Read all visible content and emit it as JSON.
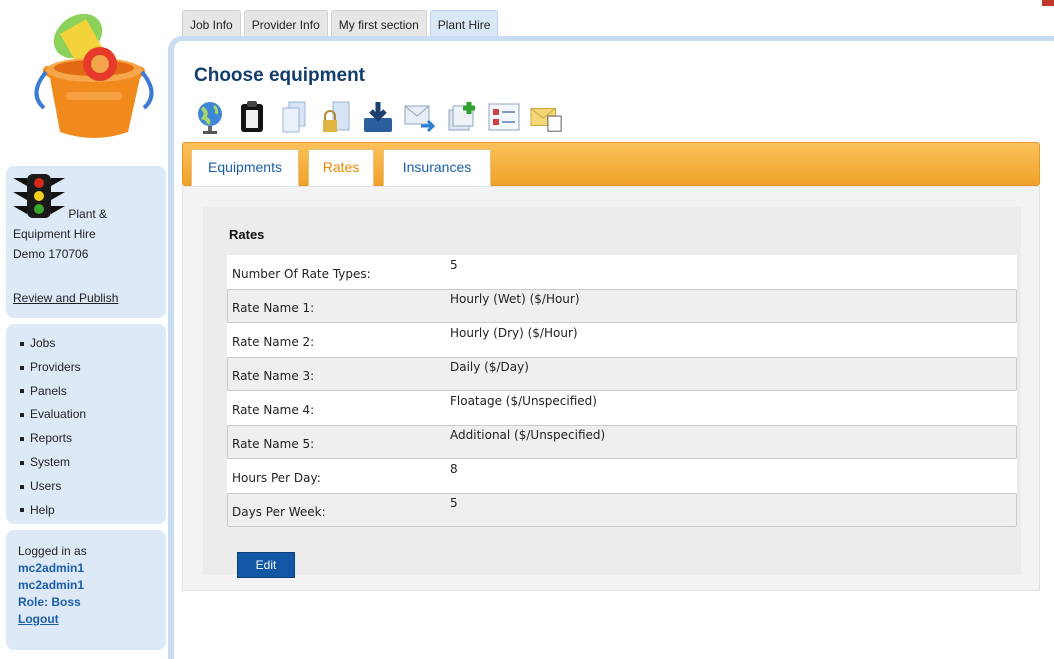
{
  "app": {
    "name_line1": "Plant &",
    "name_line2": "Equipment Hire",
    "name_line3": "Demo 170706",
    "review_link": "Review and Publish"
  },
  "nav": {
    "items": [
      "Jobs",
      "Providers",
      "Panels",
      "Evaluation",
      "Reports",
      "System",
      "Users",
      "Help"
    ]
  },
  "user": {
    "logged_in_label": "Logged in as",
    "username": "mc2admin1",
    "display_name": "mc2admin1",
    "role": "Role: Boss",
    "logout": "Logout"
  },
  "top_tabs": [
    {
      "label": "Job Info",
      "active": false
    },
    {
      "label": "Provider Info",
      "active": false
    },
    {
      "label": "My first section",
      "active": false
    },
    {
      "label": "Plant Hire",
      "active": true
    }
  ],
  "page": {
    "title": "Choose equipment"
  },
  "toolbar_icons": [
    "globe-icon",
    "clipboard-icon",
    "document-copy-icon",
    "document-lock-icon",
    "download-icon",
    "mail-forward-icon",
    "add-copy-icon",
    "form-list-icon",
    "mail-document-icon"
  ],
  "sub_tabs": {
    "equipments": "Equipments",
    "rates": "Rates",
    "insurances": "Insurances",
    "active": "rates"
  },
  "rates": {
    "heading": "Rates",
    "rows": [
      {
        "label": "Number Of Rate Types:",
        "value": "5"
      },
      {
        "label": "Rate Name 1:",
        "value": "Hourly (Wet)  ($/Hour)"
      },
      {
        "label": "Rate Name 2:",
        "value": "Hourly (Dry)  ($/Hour)"
      },
      {
        "label": "Rate Name 3:",
        "value": "Daily  ($/Day)"
      },
      {
        "label": "Rate Name 4:",
        "value": "Floatage  ($/Unspecified)"
      },
      {
        "label": "Rate Name 5:",
        "value": "Additional  ($/Unspecified)"
      },
      {
        "label": "Hours Per Day:",
        "value": "8"
      },
      {
        "label": "Days Per Week:",
        "value": "5"
      }
    ],
    "edit_button": "Edit"
  },
  "colors": {
    "accent_blue": "#1157a6",
    "tab_bar_orange": "#f0a12a",
    "active_tab_text": "#e88a00",
    "sidebar_bg": "#dde9f7"
  }
}
